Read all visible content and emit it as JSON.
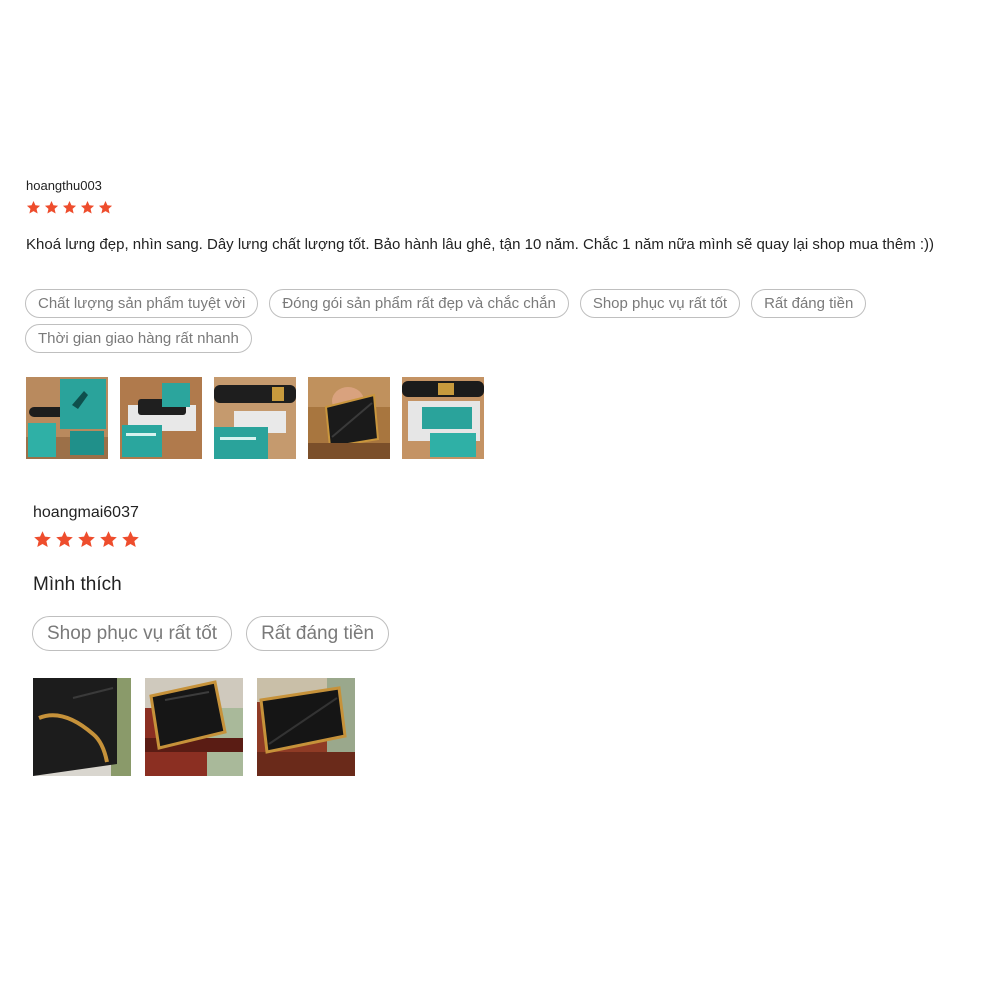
{
  "colors": {
    "star": "#ee4d2d",
    "tag_border": "#bfbfbf",
    "tag_text": "#7a7a7a"
  },
  "reviews": [
    {
      "username": "hoangthu003",
      "rating": 5,
      "comment": "Khoá lưng đẹp, nhìn sang.  Dây lưng chất lượng tốt.  Bảo hành lâu ghê,  tận 10 năm.  Chắc 1 năm nữa mình sẽ quay lại shop mua thêm :))",
      "tags": [
        "Chất lượng sản phẩm tuyệt vời",
        "Đóng gói sản phẩm rất đẹp và chắc chắn",
        "Shop phục vụ rất tốt",
        "Rất đáng tiền",
        "Thời gian giao hàng rất nhanh"
      ],
      "photo_count": 5
    },
    {
      "username": "hoangmai6037",
      "rating": 5,
      "comment": "Mình thích",
      "tags": [
        "Shop phục vụ rất tốt",
        "Rất đáng tiền"
      ],
      "photo_count": 3
    }
  ]
}
